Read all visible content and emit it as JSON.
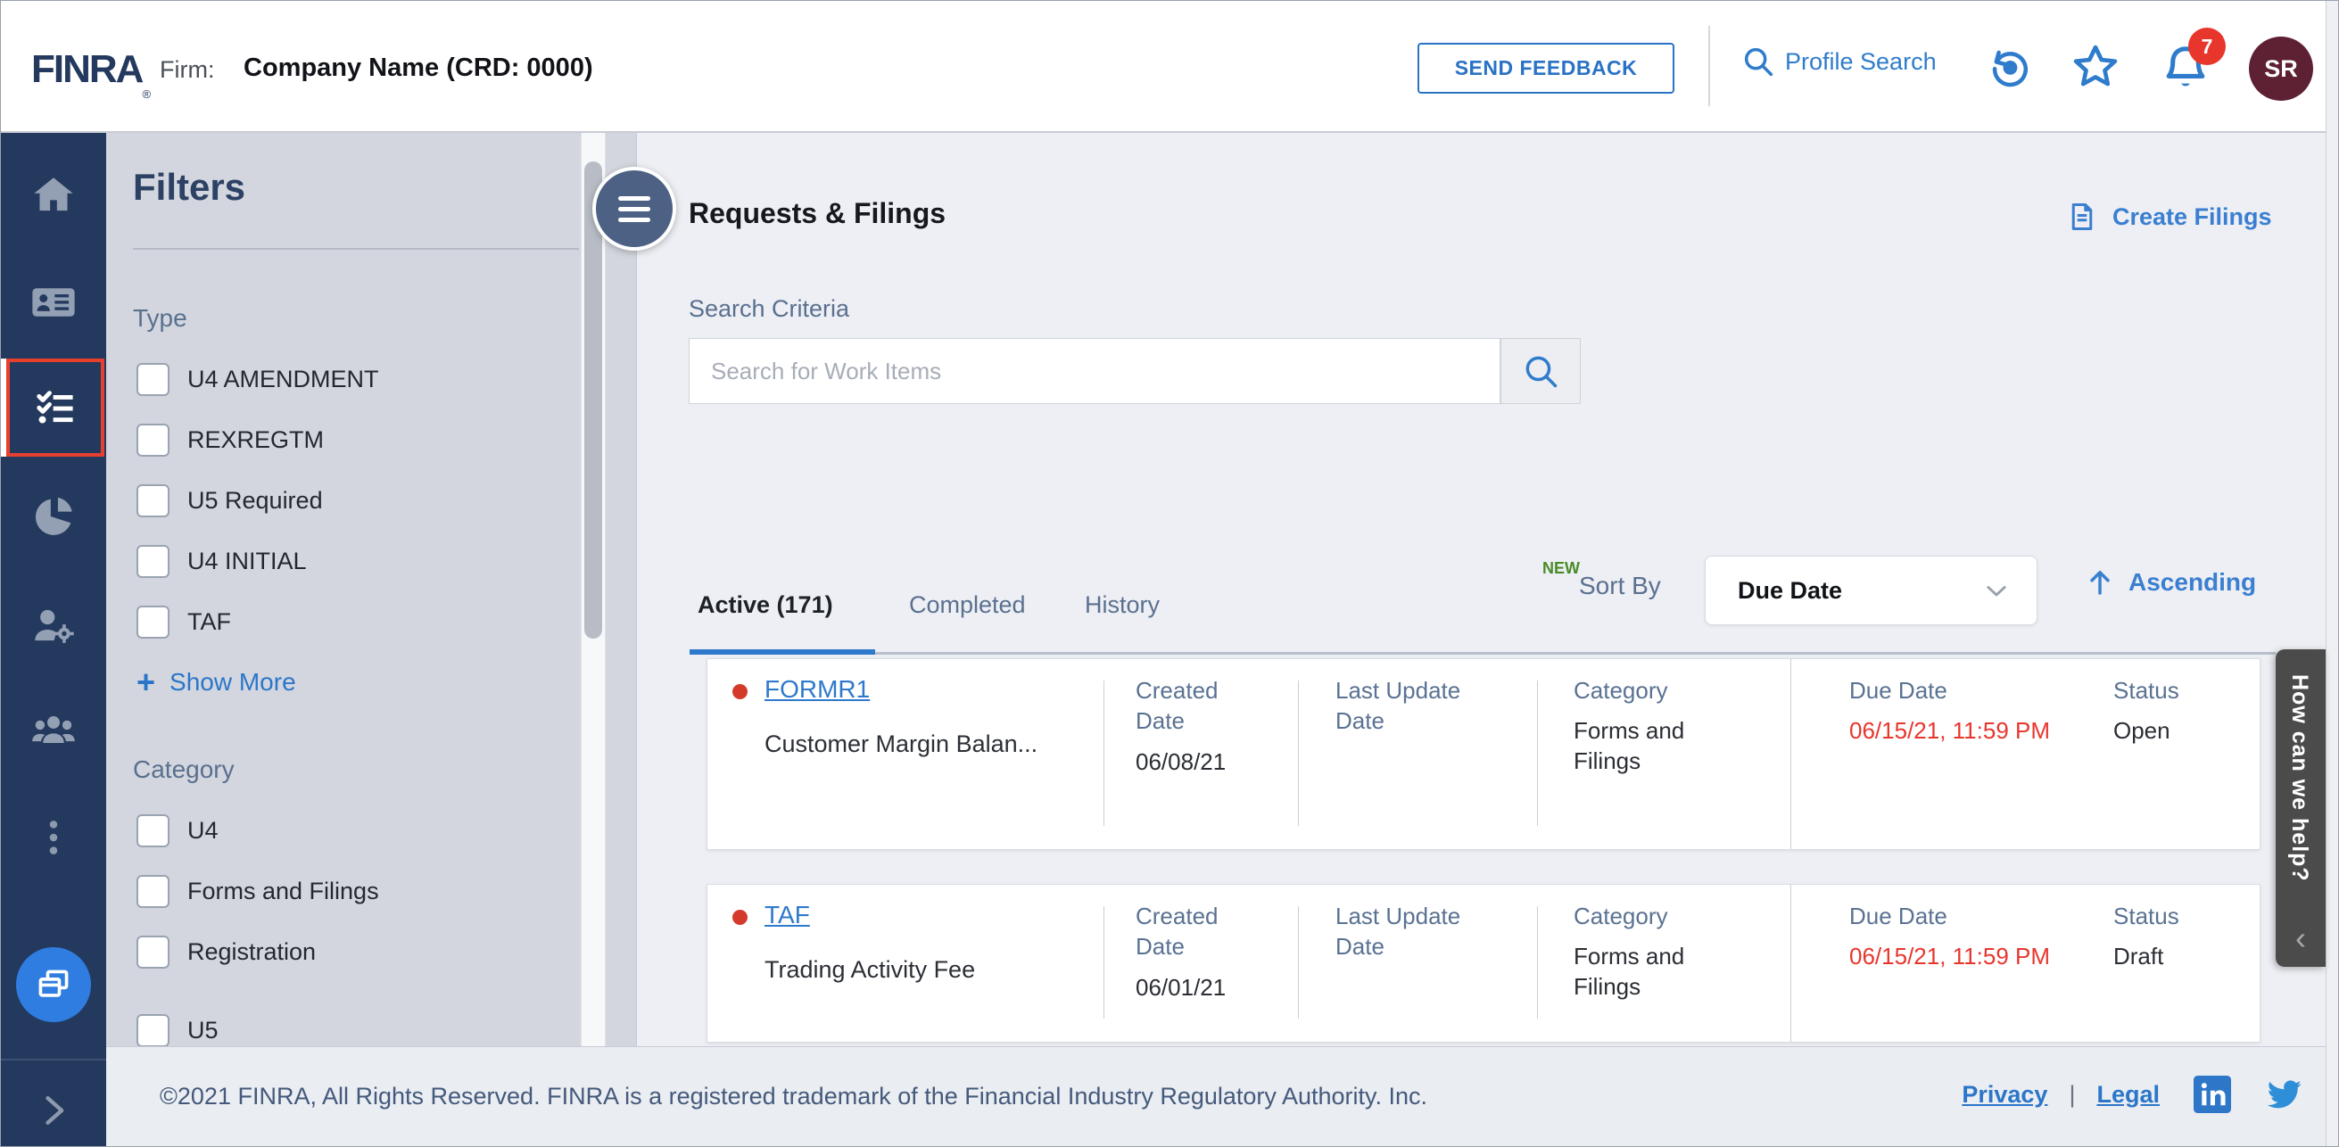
{
  "colors": {
    "accent_blue": "#2e79cb",
    "icon_blue": "#2e7ccb",
    "sidebar_navy": "#24395e",
    "alert_red": "#e8362d",
    "new_green": "#4a8b27",
    "avatar_maroon": "#5e2033",
    "help_gray": "#4b4b4b",
    "filter_panel_gray": "#d3d6de"
  },
  "header": {
    "logo": "FINRA",
    "logo_reg": "®",
    "firm_label": "Firm:",
    "firm_name": "Company Name (CRD: 0000)",
    "send_feedback": "SEND FEEDBACK",
    "profile_search": "Profile Search",
    "notification_count": "7",
    "avatar_initials": "SR"
  },
  "sidebar": {
    "icons": [
      "home",
      "id-card",
      "work-items-checklist",
      "reports-pie-chart",
      "user-admin",
      "groups",
      "more-options",
      "multi-window",
      "expand"
    ]
  },
  "filters": {
    "title": "Filters",
    "sections": [
      {
        "label": "Type",
        "options": [
          "U4 AMENDMENT",
          "REXREGTM",
          "U5 Required",
          "U4 INITIAL",
          "TAF"
        ]
      },
      {
        "label": "Category",
        "options": [
          "U4",
          "Forms and Filings",
          "Registration",
          "U5"
        ]
      }
    ],
    "show_more_icon": "+",
    "show_more": "Show More"
  },
  "main": {
    "title": "Requests & Filings",
    "create_filings": "Create Filings",
    "search_criteria_label": "Search Criteria",
    "search_placeholder": "Search for Work Items",
    "tabs": [
      {
        "label": "Active (171)",
        "active": true
      },
      {
        "label": "Completed",
        "active": false
      },
      {
        "label": "History",
        "active": false
      }
    ],
    "sort": {
      "new_badge": "NEW",
      "label": "Sort By",
      "selected": "Due Date",
      "direction": "Ascending"
    },
    "row_labels": {
      "created": "Created Date",
      "last_update": "Last Update Date",
      "category": "Category",
      "due": "Due Date",
      "status": "Status"
    },
    "rows": [
      {
        "id": "FORMR1",
        "title": "Customer Margin Balan...",
        "created": "06/08/21",
        "last_update": "",
        "category": "Forms and Filings",
        "due": "06/15/21, 11:59 PM",
        "status": "Open"
      },
      {
        "id": "TAF",
        "title": "Trading Activity Fee",
        "created": "06/01/21",
        "last_update": "",
        "category": "Forms and Filings",
        "due": "06/15/21, 11:59 PM",
        "status": "Draft"
      }
    ]
  },
  "help_tab": {
    "label": "How can we help?",
    "collapse_icon": "‹"
  },
  "footer": {
    "copyright": "©2021 FINRA, All Rights Reserved. FINRA is a registered trademark of the Financial Industry Regulatory Authority. Inc.",
    "privacy": "Privacy",
    "separator": "|",
    "legal": "Legal"
  }
}
